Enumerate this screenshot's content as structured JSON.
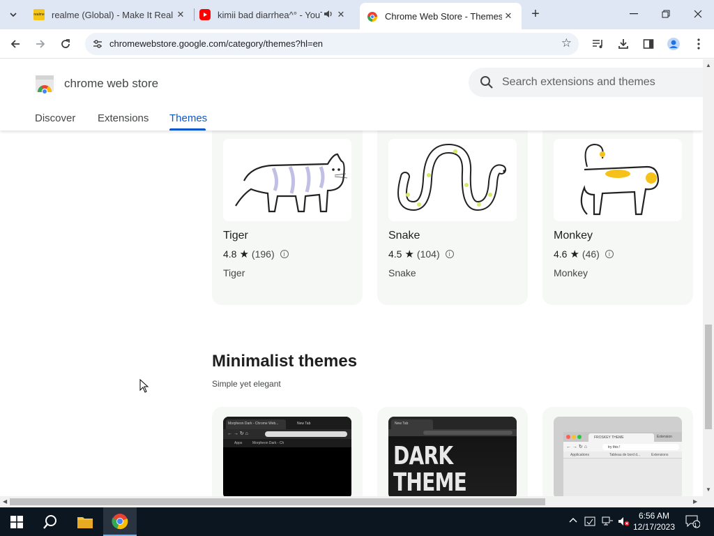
{
  "browser": {
    "tabs": [
      {
        "title": "realme (Global) - Make It Real",
        "favicon": "realme-favicon",
        "active": false
      },
      {
        "title": "kimii bad diarrhea^° - YouTube",
        "favicon": "youtube-favicon",
        "active": false
      },
      {
        "title": "Chrome Web Store - Themes",
        "favicon": "chrome-webstore-favicon",
        "active": true
      }
    ],
    "url": "chromewebstore.google.com/category/themes?hl=en"
  },
  "store": {
    "name": "chrome web store",
    "search_placeholder": "Search extensions and themes",
    "nav": [
      "Discover",
      "Extensions",
      "Themes"
    ],
    "active_nav": "Themes"
  },
  "cards": [
    {
      "name": "Tiger",
      "rating": "4.8",
      "count": "(196)",
      "desc": "Tiger"
    },
    {
      "name": "Snake",
      "rating": "4.5",
      "count": "(104)",
      "desc": "Snake"
    },
    {
      "name": "Monkey",
      "rating": "4.6",
      "count": "(46)",
      "desc": "Monkey"
    }
  ],
  "section": {
    "title": "Minimalist themes",
    "subtitle": "Simple yet elegant"
  },
  "minimal_cards": [
    {
      "tab_label": "Morpheon Dark - Chrome Web...",
      "newtab": "New Tab",
      "bookmarks": "Apps",
      "bm2": "Morpheon Dark - Ch"
    },
    {
      "tab_label": "New Tab",
      "line1": "DARK",
      "line2": "THEME"
    },
    {
      "tab_label": "FROSKEY THEME",
      "tab2": "Extension",
      "address": "try this !",
      "bm1": "Applications",
      "bm2": "Tableau de bord d...",
      "bm3": "Extensions"
    }
  ],
  "taskbar": {
    "time": "6:56 AM",
    "date": "12/17/2023",
    "notif_count": "1"
  },
  "colors": {
    "accent": "#0b57d0",
    "tabstrip": "#dfe7f5",
    "taskbar": "#0c1620"
  }
}
